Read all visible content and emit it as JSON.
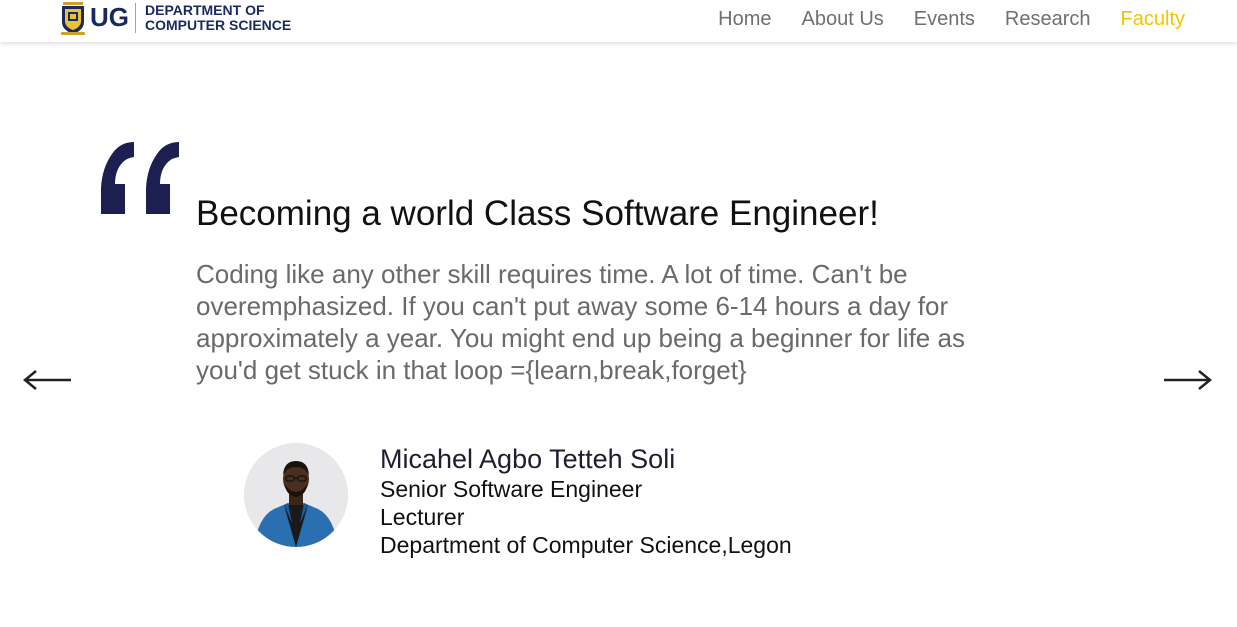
{
  "header": {
    "logo_text": "UG",
    "department_line1": "DEPARTMENT OF",
    "department_line2": "COMPUTER SCIENCE",
    "nav": [
      {
        "label": "Home"
      },
      {
        "label": "About Us"
      },
      {
        "label": "Events"
      },
      {
        "label": "Research"
      },
      {
        "label": "Faculty",
        "active": true
      }
    ],
    "nav_color": "#707070",
    "active_color": "#f2c400",
    "brand_color": "#1b2a5e"
  },
  "testimonial": {
    "quote_icon": "quote-icon",
    "quote_color": "#1c1f4f",
    "headline": "Becoming a world Class Software Engineer!",
    "body": "Coding like any other skill requires time. A lot of time. Can't be overemphasized. If you can't put away some 6-14 hours a day for approximately a year. You might end up being a beginner for life as you'd get stuck in that loop ={learn,break,forget}",
    "author": {
      "name": "Micahel Agbo Tetteh Soli",
      "title": "Senior Software Engineer",
      "role": "Lecturer",
      "affiliation": "Department of Computer Science,Legon"
    }
  },
  "carousel": {
    "prev_icon": "arrow-left-icon",
    "next_icon": "arrow-right-icon"
  }
}
